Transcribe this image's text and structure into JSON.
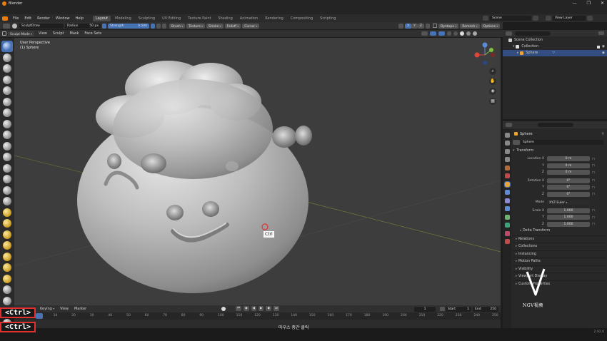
{
  "window": {
    "title": "Blender",
    "controls": [
      "—",
      "❐",
      "✕"
    ]
  },
  "menu": {
    "items": [
      "File",
      "Edit",
      "Render",
      "Window",
      "Help"
    ]
  },
  "workspaces": [
    "Layout",
    "Modeling",
    "Sculpting",
    "UV Editing",
    "Texture Paint",
    "Shading",
    "Animation",
    "Rendering",
    "Compositing",
    "Scripting"
  ],
  "active_workspace": "Layout",
  "scene": {
    "name": "Scene",
    "view_layer": "View Layer"
  },
  "tool_header": {
    "brush": "SculptDraw",
    "radius_label": "Radius",
    "radius_value": "50 px",
    "strength_label": "Strength",
    "strength_value": "0.500",
    "menus": [
      "Brush",
      "Texture",
      "Stroke",
      "Falloff",
      "Cursor"
    ],
    "symmetry": [
      "X",
      "Y",
      "Z"
    ],
    "dyntopo": "Dyntopo",
    "remesh": "Remesh",
    "options": "Options"
  },
  "viewport_header": {
    "mode": "Sculpt Mode",
    "menus": [
      "View",
      "Sculpt",
      "Mask",
      "Face Sets"
    ]
  },
  "viewport": {
    "info_line1": "User Perspective",
    "info_line2": "(1) Sphere",
    "cursor_tooltip": "Ctrl"
  },
  "outliner": {
    "root": "Scene Collection",
    "collection": "Collection",
    "object": "Sphere"
  },
  "properties": {
    "object_name": "Sphere",
    "datablock": "Sphere",
    "transform_label": "Transform",
    "location": {
      "label": "Location X",
      "x": "0 m",
      "y": "0 m",
      "z": "0 m"
    },
    "rotation": {
      "label": "Rotation X",
      "x": "0°",
      "y": "0°",
      "z": "0°"
    },
    "mode_label": "Mode",
    "mode_value": "XYZ Euler",
    "scale": {
      "label": "Scale X",
      "x": "1.000",
      "y": "1.000",
      "z": "1.000"
    },
    "axis_y": "Y",
    "axis_z": "Z",
    "delta": "Delta Transform",
    "panels": [
      "Relations",
      "Collections",
      "Instancing",
      "Motion Paths",
      "Visibility",
      "Viewport Display",
      "Custom Properties"
    ]
  },
  "watermark": {
    "text": "NGV视频"
  },
  "timeline": {
    "menus": [
      "Keying",
      "View",
      "Marker"
    ],
    "frame_current": "1",
    "start_label": "Start",
    "start_value": "1",
    "end_label": "End",
    "end_value": "250",
    "ruler": [
      "0",
      "10",
      "20",
      "30",
      "40",
      "50",
      "60",
      "70",
      "80",
      "90",
      "100",
      "110",
      "120",
      "130",
      "140",
      "150",
      "160",
      "170",
      "180",
      "190",
      "200",
      "210",
      "220",
      "230",
      "240",
      "250"
    ]
  },
  "status": {
    "hint": "마우스 중간 클릭",
    "version": "2.92.0",
    "key_overlay_1": "<Ctrl>",
    "key_overlay_2": "<Ctrl>"
  }
}
